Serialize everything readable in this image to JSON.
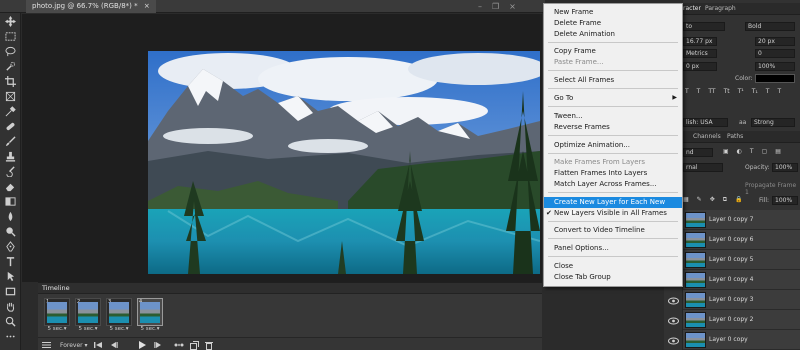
{
  "document": {
    "tab_title": "photo.jpg @ 66.7% (RGB/8*) *",
    "close_glyph": "×"
  },
  "window_controls": {
    "minimize": "–",
    "restore": "❐",
    "close": "×"
  },
  "toolbar": {
    "tools": [
      "move-tool",
      "marquee-tool",
      "lasso-tool",
      "quick-select-tool",
      "crop-tool",
      "frame-tool",
      "eyedropper-tool",
      "spot-heal-tool",
      "brush-tool",
      "clone-stamp-tool",
      "history-brush-tool",
      "eraser-tool",
      "gradient-tool",
      "blur-tool",
      "dodge-tool",
      "pen-tool",
      "type-tool",
      "path-select-tool",
      "shape-tool",
      "hand-tool",
      "zoom-tool",
      "edit-toolbar-tool"
    ]
  },
  "timeline": {
    "title": "Timeline",
    "frames": [
      {
        "number": "1",
        "delay": "5 sec.▾"
      },
      {
        "number": "2",
        "delay": "5 sec.▾"
      },
      {
        "number": "3",
        "delay": "5 sec.▾"
      },
      {
        "number": "4",
        "delay": "5 sec.▾"
      }
    ],
    "loop": "Forever ▾"
  },
  "menu": {
    "items": [
      {
        "label": "New Frame",
        "state": "enabled"
      },
      {
        "label": "Delete Frame",
        "state": "enabled"
      },
      {
        "label": "Delete Animation",
        "state": "enabled"
      },
      {
        "label": "Copy Frame",
        "state": "enabled"
      },
      {
        "label": "Paste Frame...",
        "state": "disabled"
      },
      {
        "label": "Select All Frames",
        "state": "enabled"
      },
      {
        "label": "Go To",
        "state": "enabled",
        "submenu": "▶"
      },
      {
        "label": "Tween...",
        "state": "enabled"
      },
      {
        "label": "Reverse Frames",
        "state": "enabled"
      },
      {
        "label": "Optimize Animation...",
        "state": "enabled"
      },
      {
        "label": "Make Frames From Layers",
        "state": "disabled"
      },
      {
        "label": "Flatten Frames Into Layers",
        "state": "enabled"
      },
      {
        "label": "Match Layer Across Frames...",
        "state": "enabled"
      },
      {
        "label": "Create New Layer for Each New Frame",
        "state": "highlighted"
      },
      {
        "label": "New Layers Visible in All Frames",
        "state": "checked",
        "check": "✔"
      },
      {
        "label": "Convert to Video Timeline",
        "state": "enabled"
      },
      {
        "label": "Panel Options...",
        "state": "enabled"
      },
      {
        "label": "Close",
        "state": "enabled"
      },
      {
        "label": "Close Tab Group",
        "state": "enabled"
      }
    ]
  },
  "character_panel": {
    "tab_character": "racter",
    "tab_paragraph": "Paragraph",
    "font_family": "to",
    "font_style": "Bold",
    "font_size": "16.77 px",
    "leading": "20 px",
    "kerning": "Metrics",
    "tracking": "0",
    "vscale": "0 px",
    "hscale": "100%",
    "color_label": "Color:",
    "language": "lish: USA",
    "aa_label": "aa",
    "antialias": "Strong",
    "baseline": "100%"
  },
  "layers_panel": {
    "tab_channels": "Channels",
    "tab_paths": "Paths",
    "filter_kind": "nd",
    "blend_mode": "rnal",
    "opacity_label": "Opacity:",
    "opacity": "100%",
    "propagate_label": "Propagate Frame 1",
    "fill_label": "Fill:",
    "fill": "100%",
    "layers": [
      "Layer 0 copy 7",
      "Layer 0 copy 6",
      "Layer 0 copy 5",
      "Layer 0 copy 4",
      "Layer 0 copy 3",
      "Layer 0 copy 2",
      "Layer 0 copy"
    ]
  },
  "colors": {
    "highlight": "#1b8ae0",
    "menu_bg": "#f0f0f0",
    "panel_bg": "#323232",
    "canvas_bg": "#1e1e1e"
  }
}
